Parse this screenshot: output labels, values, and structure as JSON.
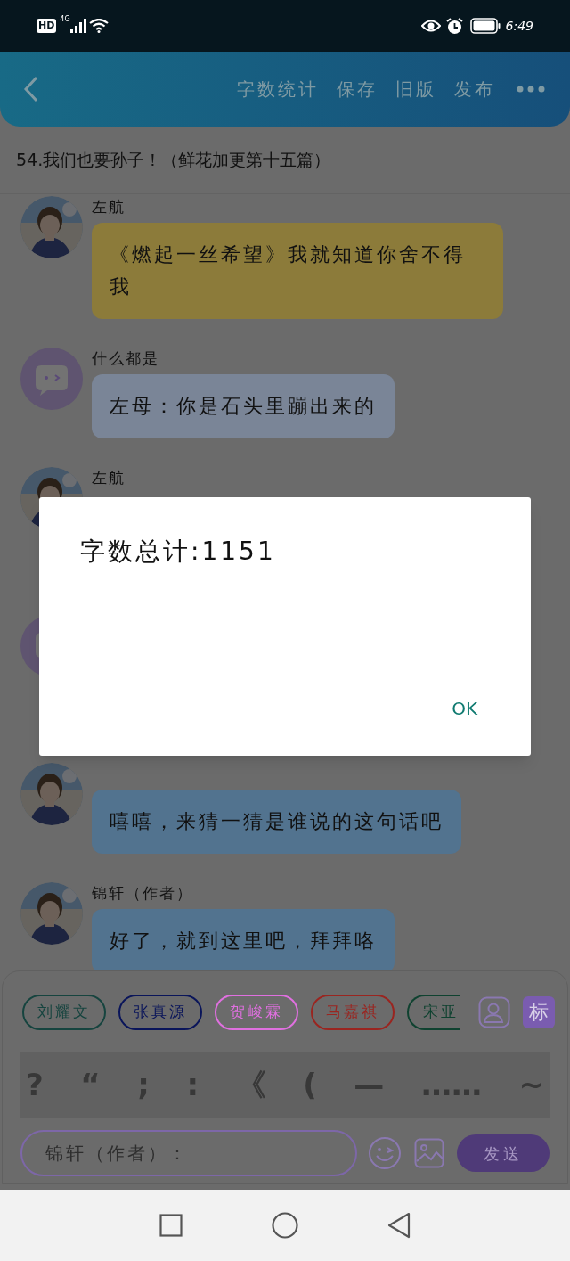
{
  "status_bar": {
    "left": [
      "HD",
      "4G"
    ],
    "time": "6:49"
  },
  "header": {
    "actions": [
      "字数统计",
      "保存",
      "旧版",
      "发布"
    ]
  },
  "chapter_title": "54.我们也要孙子！（鲜花加更第十五篇）",
  "messages": [
    {
      "name": "左航",
      "text": "《燃起一丝希望》我就知道你舍不得我",
      "color": "#8c7b3a"
    },
    {
      "avatar": {
        "kind": "icon"
      },
      "name": "什么都是",
      "text": "左母：你是石头里蹦出来的",
      "color": "#7a8597"
    },
    {
      "name": "左航"
    },
    {
      "avatar": {
        "kind": "icon"
      }
    },
    {
      "text": "嘻嘻，来猜一猜是谁说的这句话吧",
      "color": "#52738f"
    },
    {
      "name": "锦轩（作者）",
      "text": "好了，就到这里吧，拜拜咯",
      "color": "#52738f"
    }
  ],
  "characters": [
    {
      "name": "刘耀文",
      "color": "#16443f"
    },
    {
      "name": "张真源",
      "color": "#0a155a"
    },
    {
      "name": "贺峻霖",
      "color": "#e070e0"
    },
    {
      "name": "马嘉祺",
      "color": "#9a2520"
    },
    {
      "name": "宋亚",
      "color": "#0f4230"
    }
  ],
  "tag_button": "标",
  "punctuation": [
    "?",
    "“",
    ";",
    ":",
    "《",
    "(",
    "—",
    "……",
    "~"
  ],
  "composer": {
    "placeholder": "锦轩（作者）：",
    "send": "发送"
  },
  "dialog": {
    "message": "字数总计:1151",
    "button": "OK"
  }
}
